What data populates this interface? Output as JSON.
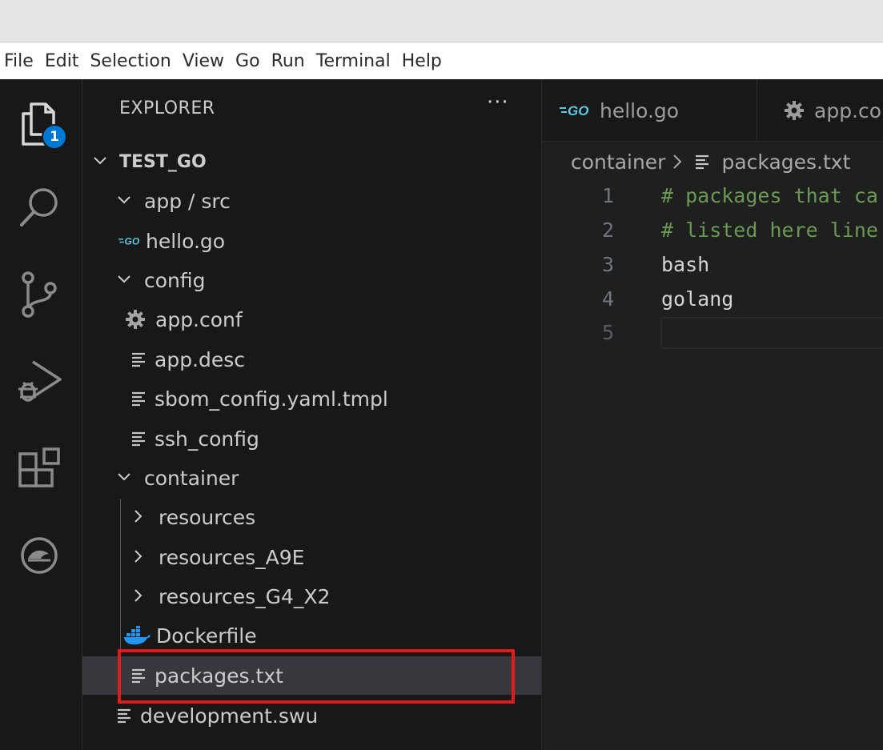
{
  "menu": [
    "File",
    "Edit",
    "Selection",
    "View",
    "Go",
    "Run",
    "Terminal",
    "Help"
  ],
  "activity_bar": {
    "items": [
      {
        "icon": "files-icon",
        "badge": "1"
      },
      {
        "icon": "search-icon"
      },
      {
        "icon": "source-control-icon"
      },
      {
        "icon": "run-debug-icon"
      },
      {
        "icon": "extensions-icon"
      },
      {
        "icon": "remote-explorer-icon"
      }
    ]
  },
  "explorer": {
    "title": "EXPLORER",
    "more": "···",
    "root": "TEST_GO",
    "tree": [
      {
        "label": "app / src",
        "type": "folder",
        "expanded": true
      },
      {
        "label": "hello.go",
        "type": "go"
      },
      {
        "label": "config",
        "type": "folder",
        "expanded": true
      },
      {
        "label": "app.conf",
        "type": "gear"
      },
      {
        "label": "app.desc",
        "type": "text"
      },
      {
        "label": "sbom_config.yaml.tmpl",
        "type": "text"
      },
      {
        "label": "ssh_config",
        "type": "text"
      },
      {
        "label": "container",
        "type": "folder",
        "expanded": true
      },
      {
        "label": "resources",
        "type": "folder",
        "expanded": false
      },
      {
        "label": "resources_A9E",
        "type": "folder",
        "expanded": false
      },
      {
        "label": "resources_G4_X2",
        "type": "folder",
        "expanded": false
      },
      {
        "label": "Dockerfile",
        "type": "docker"
      },
      {
        "label": "packages.txt",
        "type": "text",
        "selected": true
      },
      {
        "label": "development.swu",
        "type": "text"
      }
    ]
  },
  "editor": {
    "tabs": [
      {
        "label": "hello.go",
        "icon": "go-icon"
      },
      {
        "label": "app.co",
        "icon": "gear-icon"
      }
    ],
    "breadcrumb": [
      "container",
      "packages.txt"
    ],
    "lines": [
      {
        "num": "1",
        "text": "# packages that ca",
        "comment": true
      },
      {
        "num": "2",
        "text": "# listed here line",
        "comment": true
      },
      {
        "num": "3",
        "text": "bash",
        "comment": false
      },
      {
        "num": "4",
        "text": "golang",
        "comment": false
      },
      {
        "num": "5",
        "text": "",
        "comment": false
      }
    ]
  },
  "colors": {
    "highlight": "#e01b1b",
    "badge": "#0078d4",
    "comment": "#6a9955",
    "go": "#5dc9e2",
    "docker": "#2496ed"
  }
}
